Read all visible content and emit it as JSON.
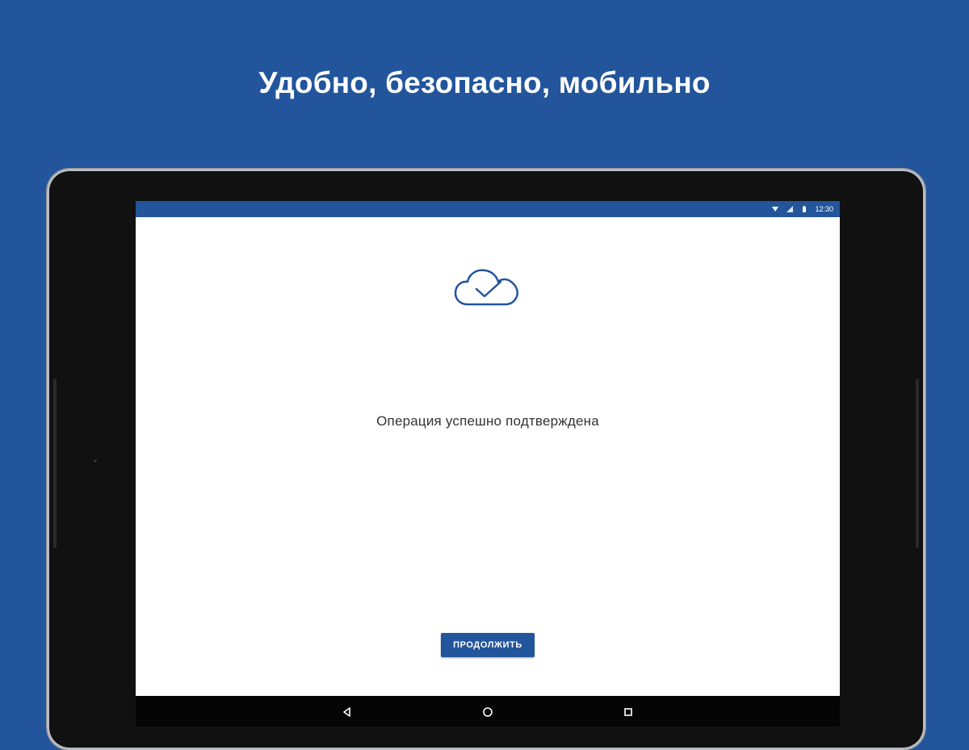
{
  "headline": "Удобно, безопасно, мобильно",
  "status_bar": {
    "time": "12:30",
    "icons": [
      "wifi-icon",
      "signal-icon",
      "battery-icon"
    ]
  },
  "screen": {
    "icon": "cloud-check-icon",
    "message": "Операция успешно подтверждена",
    "continue_label": "ПРОДОЛЖИТЬ"
  },
  "navigation": {
    "buttons": [
      "back-icon",
      "home-icon",
      "recent-apps-icon"
    ]
  },
  "colors": {
    "brand_blue": "#22559b",
    "screen_background": "#ffffff",
    "device_bezel": "#111111"
  }
}
